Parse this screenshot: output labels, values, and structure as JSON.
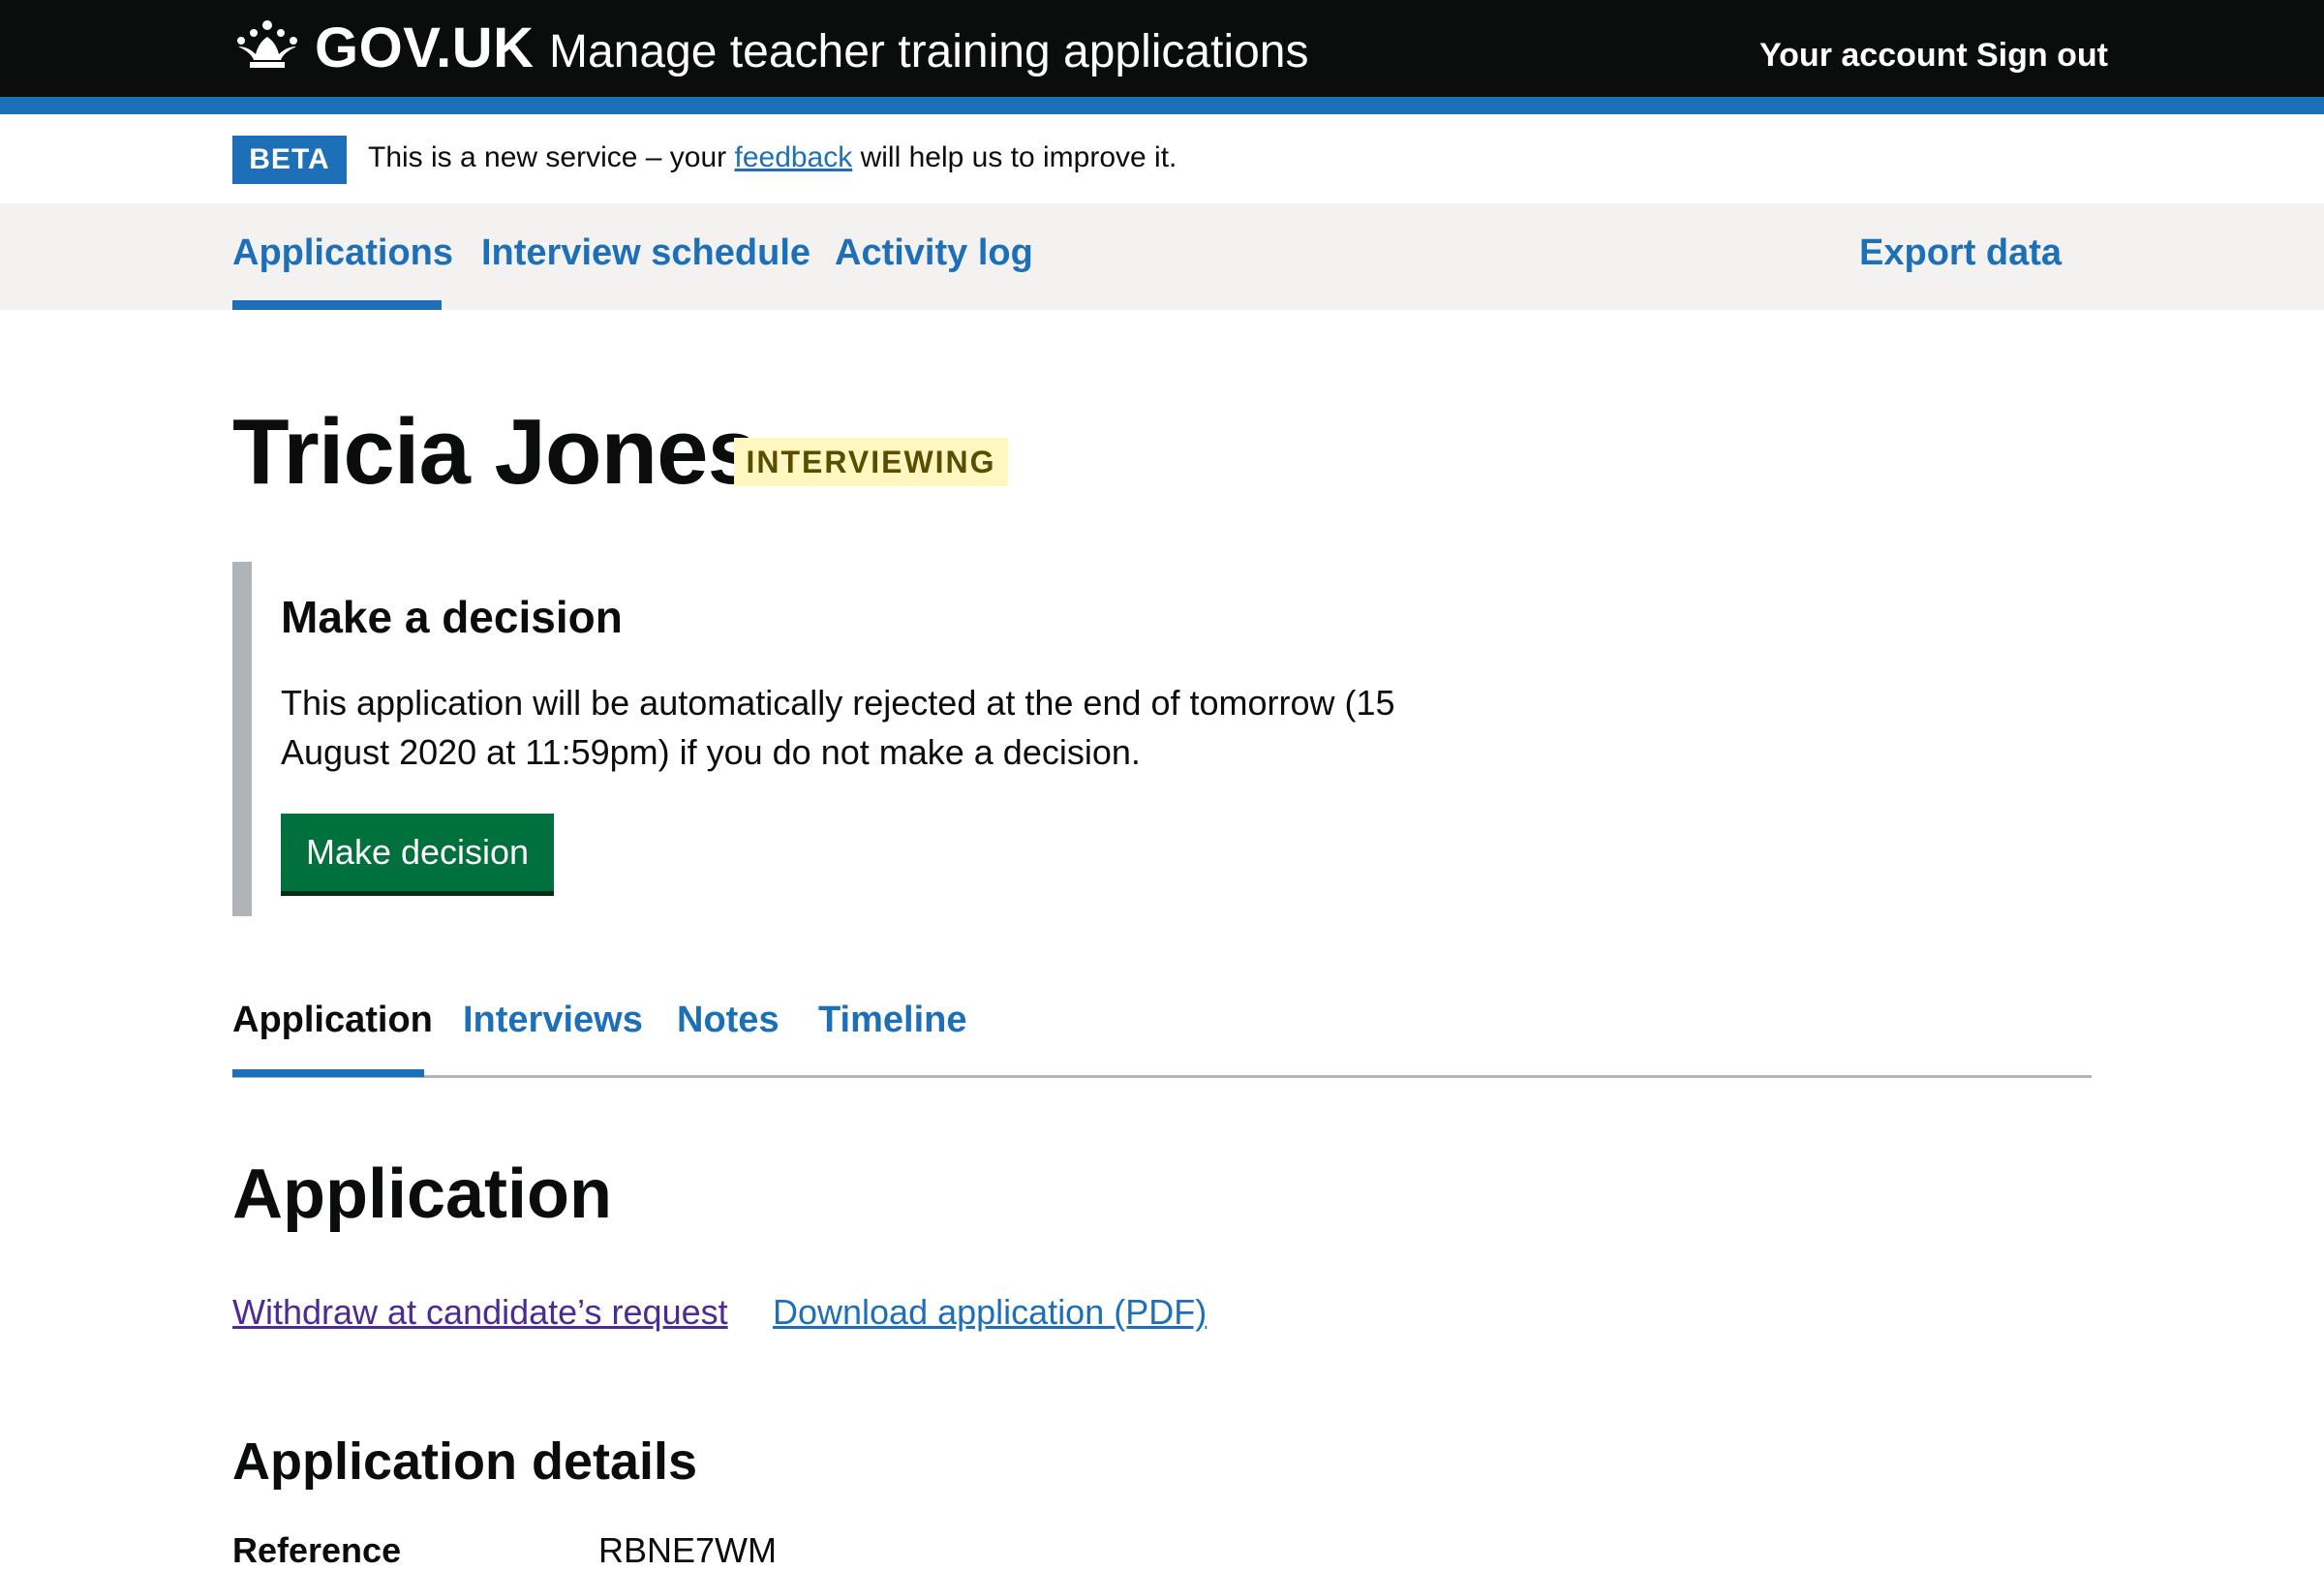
{
  "header": {
    "logotype": "GOV.UK",
    "service_name": "Manage teacher training applications",
    "links": [
      "Your account",
      "Sign out"
    ]
  },
  "beta_banner": {
    "tag": "BETA",
    "text_before": "This is a new service – your ",
    "link": "feedback",
    "text_after": " will help us to improve it."
  },
  "subnav": {
    "items": [
      "Applications",
      "Interview schedule",
      "Activity log"
    ],
    "active": "Applications",
    "export": "Export data"
  },
  "candidate": {
    "name": "Tricia Jones",
    "status": "INTERVIEWING"
  },
  "decision_panel": {
    "heading": "Make a decision",
    "body": "This application will be automatically rejected at the end of tomorrow (15 August 2020 at 11:59pm) if you do not make a decision.",
    "button": "Make decision"
  },
  "tabs": {
    "items": [
      "Application",
      "Interviews",
      "Notes",
      "Timeline"
    ],
    "active": "Application"
  },
  "application": {
    "title": "Application",
    "actions": [
      "Withdraw at candidate’s request",
      "Download application (PDF)"
    ],
    "details_heading": "Application details",
    "rows": [
      {
        "key": "Reference",
        "value": "RBNE7WM"
      }
    ]
  },
  "colors": {
    "header_bg": "#0b0c0c",
    "brand_blue": "#1d70b8",
    "button_green": "#00703c",
    "status_tag_bg": "#fff7bf",
    "status_tag_text": "#594d00",
    "visited_link": "#4c2c92"
  }
}
